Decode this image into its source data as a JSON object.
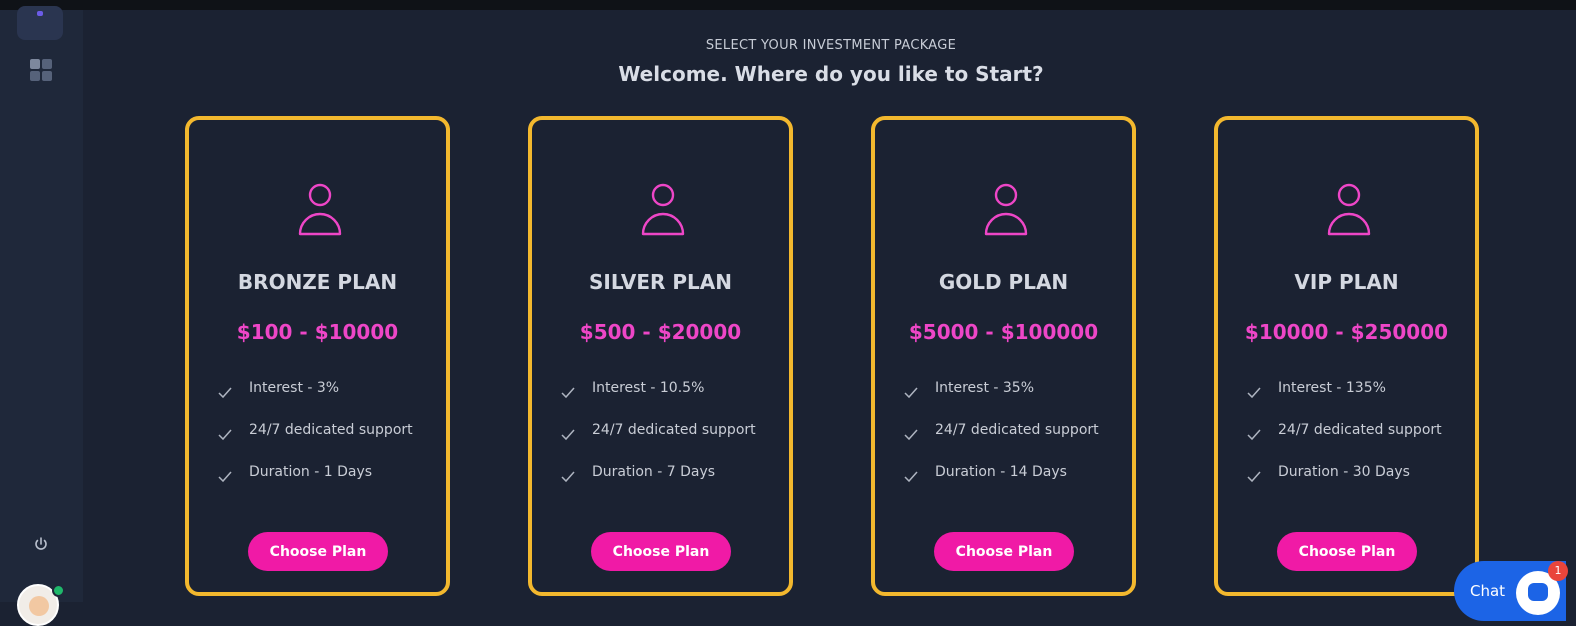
{
  "header": {
    "kicker": "SELECT YOUR INVESTMENT PACKAGE",
    "title": "Welcome. Where do you like to Start?"
  },
  "plans": [
    {
      "name": "BRONZE PLAN",
      "price": "$100 - $10000",
      "features": [
        "Interest - 3%",
        "24/7 dedicated support",
        "Duration - 1 Days"
      ],
      "button": "Choose Plan"
    },
    {
      "name": "SILVER PLAN",
      "price": "$500 - $20000",
      "features": [
        "Interest - 10.5%",
        "24/7 dedicated support",
        "Duration - 7 Days"
      ],
      "button": "Choose Plan"
    },
    {
      "name": "GOLD PLAN",
      "price": "$5000 - $100000",
      "features": [
        "Interest - 35%",
        "24/7 dedicated support",
        "Duration - 14 Days"
      ],
      "button": "Choose Plan"
    },
    {
      "name": "VIP PLAN",
      "price": "$10000 - $250000",
      "features": [
        "Interest - 135%",
        "24/7 dedicated support",
        "Duration - 30 Days"
      ],
      "button": "Choose Plan"
    }
  ],
  "chat": {
    "label": "Chat",
    "badge": "1"
  },
  "colors": {
    "background": "#1b2232",
    "sidebar": "#1f283a",
    "card_border": "#f3b82e",
    "accent_pink": "#ee46c7",
    "button_pink": "#f01aa6",
    "chat_blue": "#1c64e6"
  },
  "icons": {
    "sidebar": [
      "dashboard-grid-icon",
      "power-icon"
    ],
    "plan": "user-icon",
    "feature": "check-icon",
    "chat": "chat-bubble-icon"
  }
}
